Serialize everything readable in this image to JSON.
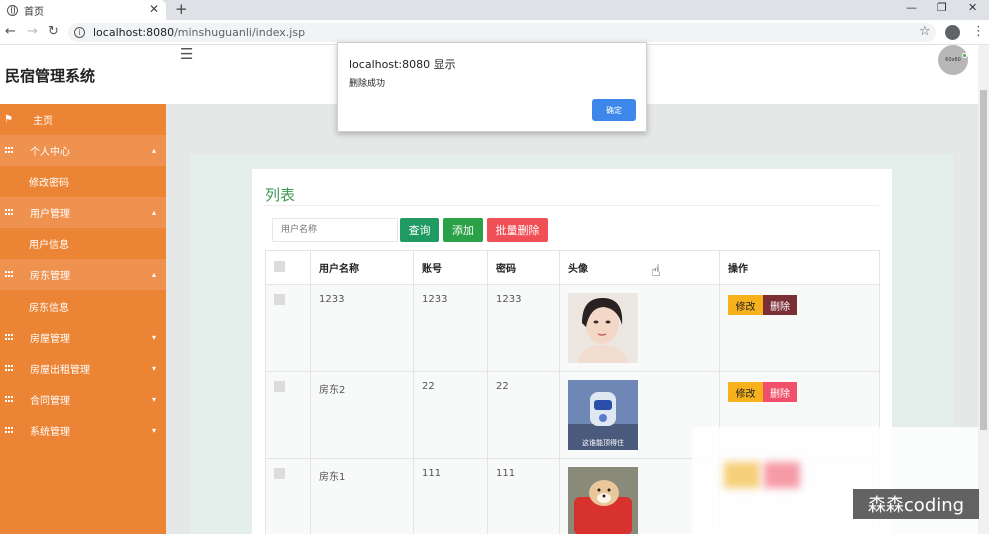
{
  "browser": {
    "tab_title": "首页",
    "url_host": "localhost:8080",
    "url_path": "/minshuguanli/index.jsp"
  },
  "app": {
    "brand": "民宿管理系统",
    "avatar_text": "60x60"
  },
  "sidebar": {
    "items": [
      {
        "label": "主页",
        "kind": "top"
      },
      {
        "label": "个人中心",
        "kind": "group",
        "arrow": "▴"
      },
      {
        "label": "修改密码",
        "kind": "sub"
      },
      {
        "label": "用户管理",
        "kind": "group",
        "arrow": "▴"
      },
      {
        "label": "用户信息",
        "kind": "sub"
      },
      {
        "label": "房东管理",
        "kind": "group",
        "arrow": "▴"
      },
      {
        "label": "房东信息",
        "kind": "sub"
      },
      {
        "label": "房屋管理",
        "kind": "collapsed",
        "arrow": "▾"
      },
      {
        "label": "房屋出租管理",
        "kind": "collapsed",
        "arrow": "▾"
      },
      {
        "label": "合同管理",
        "kind": "collapsed",
        "arrow": "▾"
      },
      {
        "label": "系统管理",
        "kind": "collapsed",
        "arrow": "▾"
      }
    ]
  },
  "panel": {
    "title": "列表",
    "search_placeholder": "用户名称",
    "query_label": "查询",
    "add_label": "添加",
    "batch_delete_label": "批量删除"
  },
  "table": {
    "headers": [
      "用户名称",
      "账号",
      "密码",
      "头像",
      "操作"
    ],
    "edit_label": "修改",
    "delete_label": "删除",
    "rows": [
      {
        "name": "1233",
        "account": "1233",
        "password": "1233",
        "delete_color": "#7a2e36"
      },
      {
        "name": "房东2",
        "account": "22",
        "password": "22",
        "avatar_caption": "这谁能顶得住",
        "delete_color": "#f0506a"
      },
      {
        "name": "房东1",
        "account": "111",
        "password": "111"
      }
    ]
  },
  "dialog": {
    "title": "localhost:8080 显示",
    "message": "删除成功",
    "ok_label": "确定"
  },
  "watermark": "森森coding",
  "colors": {
    "sidebar": "#ec8435",
    "sidebar_group": "#ef924f",
    "title_green": "#3d9a55",
    "query": "#1f9a63",
    "add": "#2ba147",
    "batch_delete": "#f04f55",
    "edit": "#f7b11a",
    "dialog_ok": "#3d86ea"
  }
}
